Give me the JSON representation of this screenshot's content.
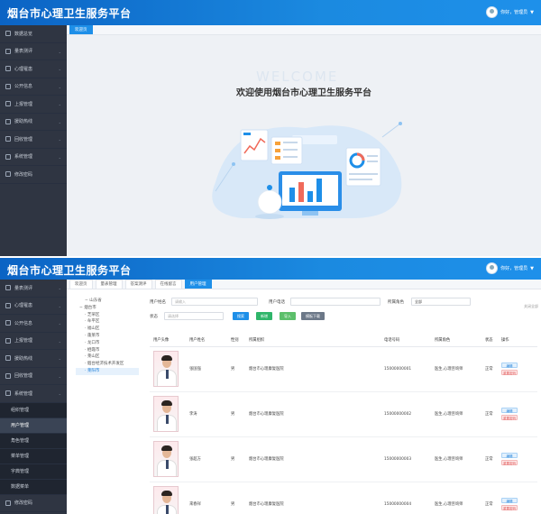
{
  "app": {
    "title": "烟台市心理卫生服务平台",
    "user_label": "你好，管理员"
  },
  "colors": {
    "header_start": "#0b63c4",
    "header_end": "#1e90ea",
    "sidebar_bg": "#2f3542",
    "accent": "#1e8fe8"
  },
  "screen1": {
    "sidebar": [
      {
        "label": "数据总览",
        "icon": "chart-icon"
      },
      {
        "label": "量表测评",
        "icon": "grid-icon"
      },
      {
        "label": "心理罹患",
        "icon": "heart-icon"
      },
      {
        "label": "公开信息",
        "icon": "info-icon"
      },
      {
        "label": "上报管理",
        "icon": "upload-icon"
      },
      {
        "label": "援助热线",
        "icon": "phone-icon"
      },
      {
        "label": "回收管理",
        "icon": "recycle-icon"
      },
      {
        "label": "系统管理",
        "icon": "gear-icon"
      },
      {
        "label": "修改密码",
        "icon": "lock-icon"
      }
    ],
    "tab": "欢迎页",
    "welcome_bg": "WELCOME",
    "welcome_title": "欢迎使用烟台市心理卫生服务平台"
  },
  "screen2": {
    "sidebar": [
      {
        "label": "量表测评",
        "icon": "grid-icon"
      },
      {
        "label": "心理罹患",
        "icon": "heart-icon"
      },
      {
        "label": "公开信息",
        "icon": "info-icon"
      },
      {
        "label": "上报管理",
        "icon": "upload-icon"
      },
      {
        "label": "援助热线",
        "icon": "phone-icon"
      },
      {
        "label": "回收管理",
        "icon": "recycle-icon"
      },
      {
        "label": "系统管理",
        "icon": "gear-icon"
      }
    ],
    "sub_items": [
      "组织管理",
      "用户管理",
      "角色管理",
      "菜单管理",
      "字典管理",
      "数据菜单"
    ],
    "active_sub": "用户管理",
    "last_item": "修改密码",
    "tabs": [
      "欢迎页",
      "量表管理",
      "答案测评",
      "在线留言",
      "用户管理"
    ],
    "close_all": "关闭全部",
    "tree": [
      "山东省",
      "烟台市",
      "芝罘区",
      "牟平区",
      "福山区",
      "蓬莱市",
      "龙口市",
      "栖霞市",
      "莱山区",
      "烟台经济技术开发区",
      "莱阳市"
    ],
    "filters": {
      "name_label": "用户姓名",
      "name_placeholder": "请输入",
      "phone_label": "用户电话",
      "phone_placeholder": "",
      "role_label": "所属角色",
      "role_value": "全部",
      "status_label": "状态",
      "status_placeholder": "请选择"
    },
    "buttons": {
      "search": "搜索",
      "add": "新增",
      "import": "导入",
      "template": "模板下载"
    },
    "columns": [
      "用户头像",
      "用户姓名",
      "性别",
      "所属组织",
      "电话号码",
      "所属角色",
      "状态",
      "操作"
    ],
    "rows": [
      {
        "name": "张国强",
        "gender": "男",
        "org": "烟台市心理康复医院",
        "phone": "15000000001",
        "role": "医生,心理咨询师",
        "status": "正常"
      },
      {
        "name": "李涛",
        "gender": "男",
        "org": "烟台市心理康复医院",
        "phone": "15000000002",
        "role": "医生,心理咨询师",
        "status": "正常"
      },
      {
        "name": "张超方",
        "gender": "男",
        "org": "烟台市心理康复医院",
        "phone": "15000000003",
        "role": "医生,心理咨询师",
        "status": "正常"
      },
      {
        "name": "来春祥",
        "gender": "男",
        "org": "烟台市心理康复医院",
        "phone": "15000000004",
        "role": "医生,心理咨询师",
        "status": "正常"
      }
    ],
    "op_edit": "编辑",
    "op_reset": "重置密码"
  }
}
